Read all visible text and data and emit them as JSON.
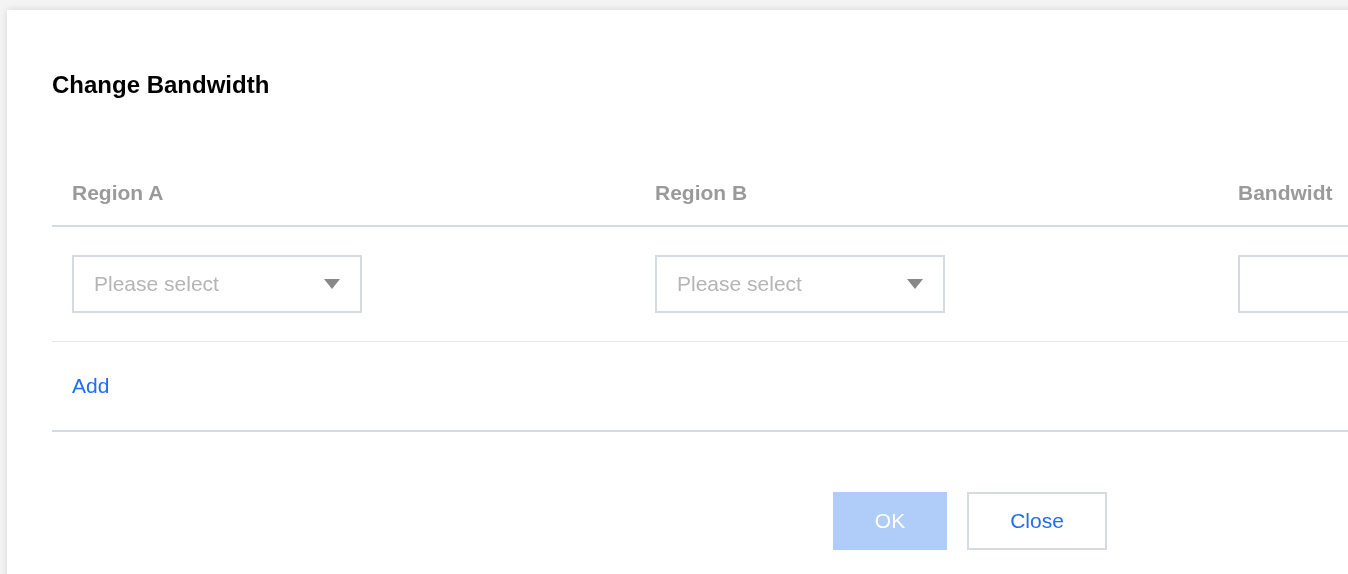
{
  "dialog": {
    "title": "Change Bandwidth"
  },
  "table": {
    "columns": [
      "Region A",
      "Region B",
      "Bandwidt"
    ],
    "rows": [
      [
        {
          "kind": "select",
          "placeholder": "Please select"
        },
        {
          "kind": "select",
          "placeholder": "Please select"
        },
        {
          "kind": "input"
        }
      ]
    ]
  },
  "add_link": "Add",
  "buttons": [
    {
      "label": "OK",
      "kind": "primary",
      "disabled": true
    },
    {
      "label": "Close",
      "kind": "secondary",
      "disabled": false
    }
  ]
}
